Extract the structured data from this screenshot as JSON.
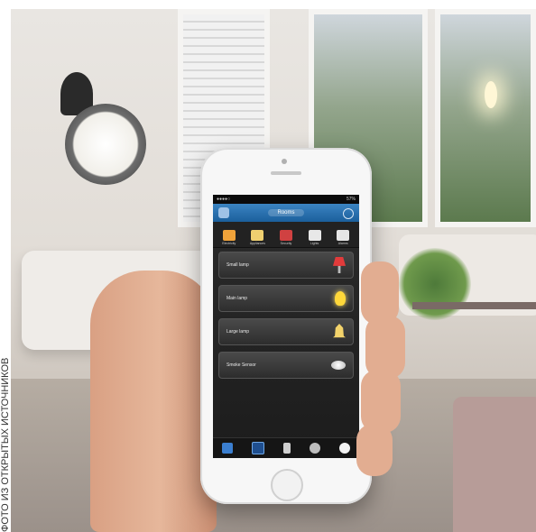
{
  "caption": "ФОТО ИЗ ОТКРЫТЫХ ИСТОЧНИКОВ",
  "phone": {
    "status_bar": {
      "carrier": "●●●●○",
      "time": "",
      "battery": "57%"
    },
    "title": "Rooms",
    "categories": [
      {
        "label": "Electricity",
        "color": "#f1a33a"
      },
      {
        "label": "Appliances",
        "color": "#f0d070"
      },
      {
        "label": "Security",
        "color": "#d04141"
      },
      {
        "label": "Lights",
        "color": "#e8e8e8"
      },
      {
        "label": "Alarms",
        "color": "#e6e6e6"
      }
    ],
    "devices": [
      {
        "label": "Small lamp",
        "icon": "lamp-icon"
      },
      {
        "label": "Main lamp",
        "icon": "bulb-icon"
      },
      {
        "label": "Large lamp",
        "icon": "bell-lamp-icon"
      },
      {
        "label": "Smoke Sensor",
        "icon": "smoke-sensor-icon"
      }
    ],
    "tab_bar": [
      "home-tab-icon",
      "rooms-tab-icon",
      "devices-tab-icon",
      "settings-tab-icon",
      "add-tab-icon"
    ]
  }
}
